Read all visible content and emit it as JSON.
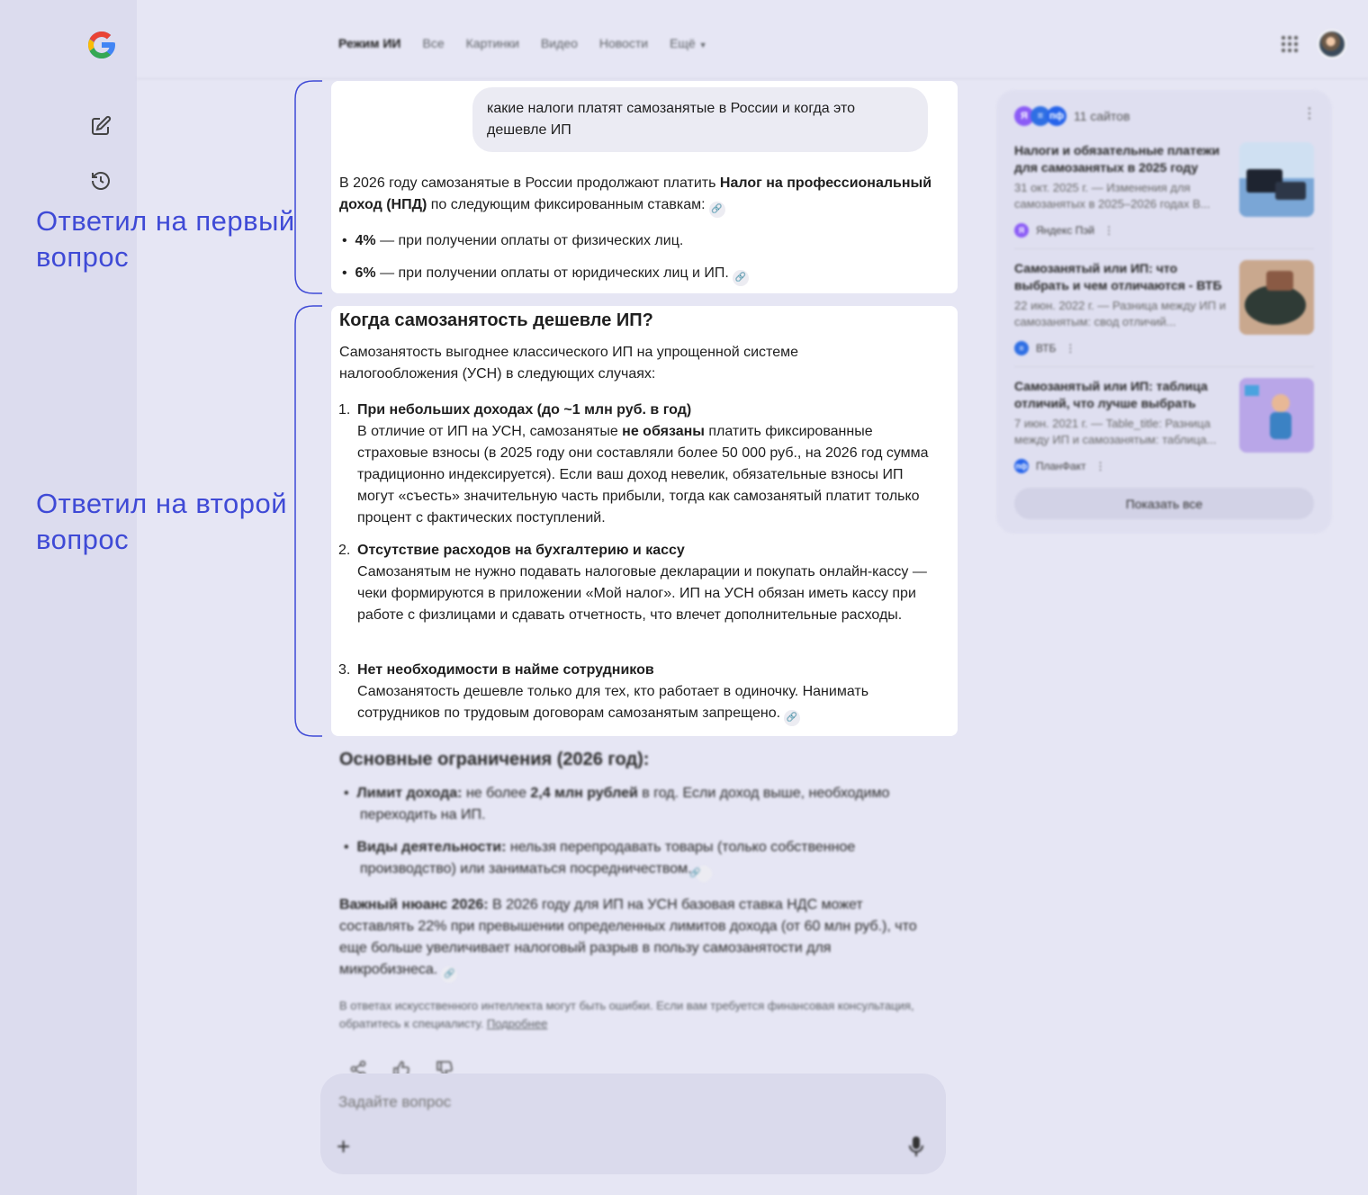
{
  "nav": {
    "tabs": [
      {
        "label": "Режим ИИ",
        "active": true
      },
      {
        "label": "Все"
      },
      {
        "label": "Картинки"
      },
      {
        "label": "Видео"
      },
      {
        "label": "Новости"
      },
      {
        "label": "Ещё"
      }
    ]
  },
  "annotations": {
    "first": "Ответил на первый вопрос",
    "second": "Ответил на второй вопрос",
    "accent_color": "#3f4ad6"
  },
  "conversation": {
    "user_query": "какие налоги платят самозанятые в России и когда это дешевле ИП",
    "answer1": {
      "intro_a": "В 2026 году самозанятые в России продолжают платить ",
      "intro_b": "Налог на профессиональный доход (НПД)",
      "intro_c": " по следующим фиксированным ставкам:",
      "rates": [
        {
          "bold": "4%",
          "text": " — при получении оплаты от физических лиц."
        },
        {
          "bold": "6%",
          "text": " — при получении оплаты от юридических лиц и ИП."
        }
      ]
    },
    "answer2": {
      "heading": "Когда самозанятость дешевле ИП?",
      "intro": "Самозанятость выгоднее классического ИП на упрощенной системе налогообложения (УСН) в следующих случаях:",
      "items": [
        {
          "num": "1.",
          "title": "При небольших доходах (до ~1 млн руб. в год)",
          "text_a": "В отличие от ИП на УСН, самозанятые ",
          "text_bold": "не обязаны",
          "text_b": " платить фиксированные страховые взносы (в 2025 году они составляли более 50 000 руб., на 2026 год сумма традиционно индексируется). Если ваш доход невелик, обязательные взносы ИП могут «съесть» значительную часть прибыли, тогда как самозанятый платит только процент с фактических поступлений."
        },
        {
          "num": "2.",
          "title": "Отсутствие расходов на бухгалтерию и кассу",
          "text": "Самозанятым не нужно подавать налоговые декларации и покупать онлайн-кассу — чеки формируются в приложении «Мой налог». ИП на УСН обязан иметь кассу при работе с физлицами и сдавать отчетность, что влечет дополнительные расходы."
        },
        {
          "num": "3.",
          "title": "Нет необходимости в найме сотрудников",
          "text": "Самозанятость дешевле только для тех, кто работает в одиночку. Нанимать сотрудников по трудовым договорам самозанятым запрещено."
        }
      ]
    },
    "limits": {
      "heading": "Основные ограничения (2026 год):",
      "items": [
        {
          "bold": "Лимит дохода:",
          "text_a": " не более ",
          "bold2": "2,4 млн рублей",
          "text_b": " в год. Если доход выше, необходимо переходить на ИП."
        },
        {
          "bold": "Виды деятельности:",
          "text": " нельзя перепродавать товары (только собственное производство) или заниматься посредничеством."
        }
      ],
      "nuance_bold": "Важный нюанс 2026:",
      "nuance_text": " В 2026 году для ИП на УСН базовая ставка НДС может составлять 22% при превышении определенных лимитов дохода (от 60 млн руб.), что еще больше увеличивает налоговый разрыв в пользу самозанятости для микробизнеса."
    },
    "disclaimer": "В ответах искусственного интеллекта могут быть ошибки. Если вам требуется финансовая консультация, обратитесь к специалисту.",
    "disclaimer_link": "Подробнее"
  },
  "prompt": {
    "placeholder": "Задайте вопрос",
    "plus": "+"
  },
  "sources": {
    "count_label": "11 сайтов",
    "favicons": [
      "Я",
      "≡",
      "пф"
    ],
    "items": [
      {
        "title": "Налоги и обязательные платежи для самозанятых в 2025 году",
        "snippet": "31 окт. 2025 г. — Изменения для самозанятых в 2025–2026 годах В...",
        "site": "Яндекс Пэй",
        "favicon": "Я",
        "favicon_color": "#8b5cf6"
      },
      {
        "title": "Самозанятый или ИП: что выбрать и чем отличаются - ВТБ",
        "snippet": "22 июн. 2022 г. — Разница между ИП и самозанятым: свод отличий...",
        "site": "ВТБ",
        "favicon": "≡",
        "favicon_color": "#2f6fe4"
      },
      {
        "title": "Самозанятый или ИП: таблица отличий, что лучше выбрать",
        "snippet": "7 июн. 2021 г. — Table_title: Разница между ИП и самозанятым: таблица...",
        "site": "ПланФакт",
        "favicon": "пф",
        "favicon_color": "#2563eb"
      }
    ],
    "show_all": "Показать все"
  }
}
